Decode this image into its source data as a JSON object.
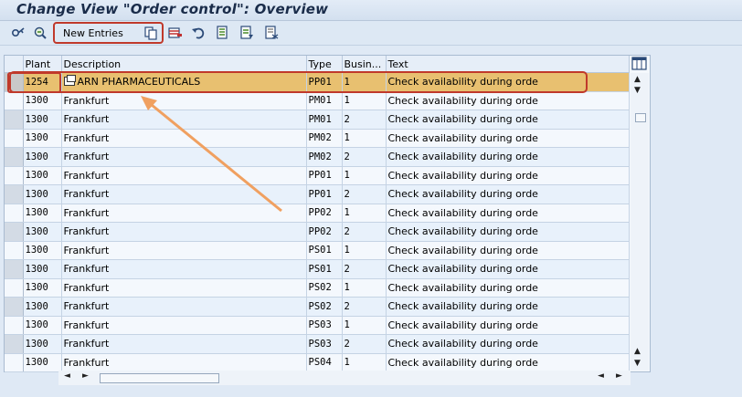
{
  "window": {
    "title": "Change View \"Order control\": Overview"
  },
  "toolbar": {
    "new_entries_label": "New Entries",
    "icons": [
      "display-change-icon",
      "find-icon",
      "copy-icon",
      "delete-icon",
      "undo-icon",
      "select-all-icon",
      "select-block-icon",
      "deselect-all-icon"
    ]
  },
  "table": {
    "columns": [
      "Plant",
      "Description",
      "Type",
      "Busin...",
      "Text"
    ],
    "rows": [
      {
        "plant": "1254",
        "description": "ARN PHARMACEUTICALS",
        "type": "PP01",
        "business": "1",
        "text": "Check availability during orde"
      },
      {
        "plant": "1300",
        "description": "Frankfurt",
        "type": "PM01",
        "business": "1",
        "text": "Check availability during orde"
      },
      {
        "plant": "1300",
        "description": "Frankfurt",
        "type": "PM01",
        "business": "2",
        "text": "Check availability during orde"
      },
      {
        "plant": "1300",
        "description": "Frankfurt",
        "type": "PM02",
        "business": "1",
        "text": "Check availability during orde"
      },
      {
        "plant": "1300",
        "description": "Frankfurt",
        "type": "PM02",
        "business": "2",
        "text": "Check availability during orde"
      },
      {
        "plant": "1300",
        "description": "Frankfurt",
        "type": "PP01",
        "business": "1",
        "text": "Check availability during orde"
      },
      {
        "plant": "1300",
        "description": "Frankfurt",
        "type": "PP01",
        "business": "2",
        "text": "Check availability during orde"
      },
      {
        "plant": "1300",
        "description": "Frankfurt",
        "type": "PP02",
        "business": "1",
        "text": "Check availability during orde"
      },
      {
        "plant": "1300",
        "description": "Frankfurt",
        "type": "PP02",
        "business": "2",
        "text": "Check availability during orde"
      },
      {
        "plant": "1300",
        "description": "Frankfurt",
        "type": "PS01",
        "business": "1",
        "text": "Check availability during orde"
      },
      {
        "plant": "1300",
        "description": "Frankfurt",
        "type": "PS01",
        "business": "2",
        "text": "Check availability during orde"
      },
      {
        "plant": "1300",
        "description": "Frankfurt",
        "type": "PS02",
        "business": "1",
        "text": "Check availability during orde"
      },
      {
        "plant": "1300",
        "description": "Frankfurt",
        "type": "PS02",
        "business": "2",
        "text": "Check availability during orde"
      },
      {
        "plant": "1300",
        "description": "Frankfurt",
        "type": "PS03",
        "business": "1",
        "text": "Check availability during orde"
      },
      {
        "plant": "1300",
        "description": "Frankfurt",
        "type": "PS03",
        "business": "2",
        "text": "Check availability during orde"
      },
      {
        "plant": "1300",
        "description": "Frankfurt",
        "type": "PS04",
        "business": "1",
        "text": "Check availability during orde"
      }
    ],
    "selected_row_index": 0
  },
  "colors": {
    "selected_row": "#e8c070",
    "highlight_box": "#c0392b",
    "annotation_arrow": "#f0a060",
    "grid_row": "#e8f1fb",
    "title_text": "#1a2c4a"
  }
}
